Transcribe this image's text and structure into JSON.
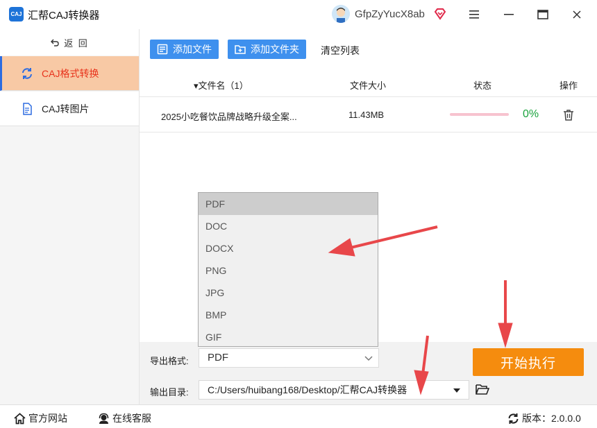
{
  "app": {
    "title": "汇帮CAJ转换器",
    "logo_text": "CAJ",
    "username": "GfpZyYucX8ab"
  },
  "sidebar": {
    "back_label": "返 回",
    "items": [
      {
        "label": "CAJ格式转换",
        "active": true
      },
      {
        "label": "CAJ转图片",
        "active": false
      }
    ]
  },
  "toolbar": {
    "add_file": "添加文件",
    "add_folder": "添加文件夹",
    "clear_list": "清空列表"
  },
  "table": {
    "columns": [
      "▾文件名（1）",
      "文件大小",
      "状态",
      "操作"
    ],
    "rows": [
      {
        "name": "2025小吃餐饮品牌战略升级全案...",
        "size": "11.43MB",
        "progress": 0,
        "status": "0%"
      }
    ]
  },
  "format_dropdown": {
    "options": [
      "PDF",
      "DOC",
      "DOCX",
      "PNG",
      "JPG",
      "BMP",
      "GIF"
    ],
    "selected": "PDF"
  },
  "settings": {
    "format_label": "导出格式:",
    "format_value": "PDF",
    "dir_label": "输出目录:",
    "dir_value": "C:/Users/huibang168/Desktop/汇帮CAJ转换器",
    "start_label": "开始执行"
  },
  "footer": {
    "website": "官方网站",
    "support": "在线客服",
    "version": "版本：2.0.0.0"
  },
  "colors": {
    "accent_blue": "#3e90ee",
    "start_orange": "#f58c0e",
    "active_bg": "#f8c9a5",
    "active_text": "#e8331c",
    "status_green": "#1aa33d",
    "arrow_red": "#e8474a"
  }
}
